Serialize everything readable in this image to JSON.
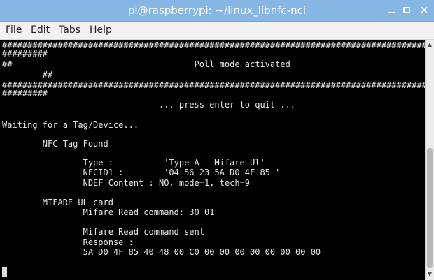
{
  "window": {
    "title": "pi@raspberrypi: ~/linux_libnfc-nci",
    "controls": {
      "minimize_icon": "minimize-icon",
      "maximize_icon": "maximize-icon",
      "close_icon": "close-icon"
    }
  },
  "menu": {
    "items": [
      "File",
      "Edit",
      "Tabs",
      "Help"
    ]
  },
  "terminal": {
    "lines": [
      "######################################################################################",
      "#########",
      "##                                    Poll mode activated",
      "        ##",
      "######################################################################################",
      "#########",
      "                               ... press enter to quit ...",
      "",
      "Waiting for a Tag/Device...",
      "",
      "        NFC Tag Found",
      "",
      "                Type :          'Type A - Mifare Ul'",
      "                NFCID1 :        '04 56 23 5A D0 4F 85 '",
      "                NDEF Content : NO, mode=1, tech=9",
      "",
      "        MIFARE UL card",
      "                Mifare Read command: 30 01",
      "",
      "                Mifare Read command sent",
      "                Response :",
      "                5A D0 4F 85 40 48 00 C0 00 00 00 00 00 00 00 00"
    ]
  },
  "colors": {
    "titlebar": "#86b6e3",
    "terminal_bg": "#000000",
    "terminal_fg": "#e8e8e8"
  }
}
